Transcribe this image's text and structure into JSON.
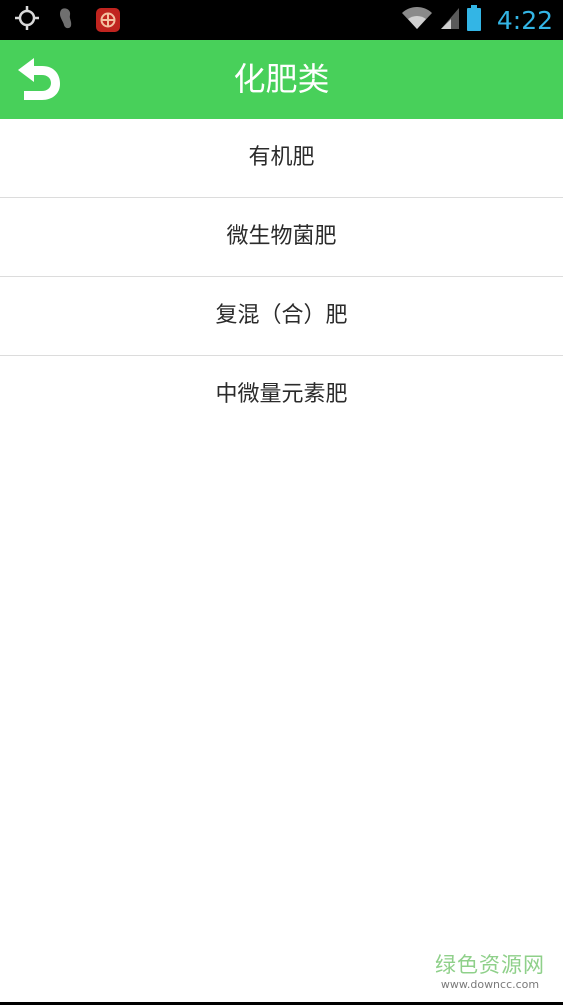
{
  "status_bar": {
    "time": "4:22",
    "icons": [
      "gps-icon",
      "footprint-icon",
      "app-badge-icon",
      "wifi-icon",
      "signal-icon",
      "battery-icon"
    ]
  },
  "nav": {
    "title": "化肥类",
    "back_icon": "back-arrow-icon",
    "color": "#48d05a"
  },
  "list": {
    "items": [
      {
        "label": "有机肥"
      },
      {
        "label": "微生物菌肥"
      },
      {
        "label": "复混（合）肥"
      },
      {
        "label": "中微量元素肥"
      }
    ]
  },
  "watermark": {
    "title": "绿色资源网",
    "url": "www.downcc.com"
  }
}
